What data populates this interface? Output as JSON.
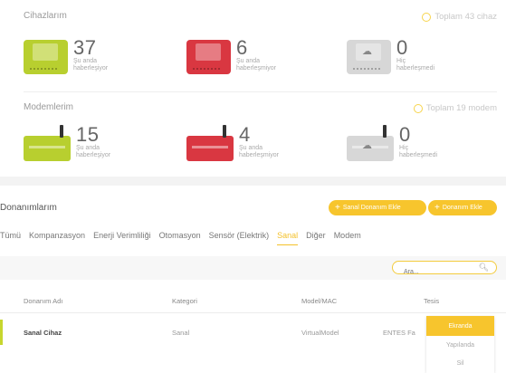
{
  "devices": {
    "title": "Cihazlarım",
    "total": "Toplam 43 cihaz",
    "stats": [
      {
        "count": "37",
        "line1": "Şu anda",
        "line2": "haberleşiyor",
        "color": "#b8cf2f"
      },
      {
        "count": "6",
        "line1": "Şu anda",
        "line2": "haberleşmiyor",
        "color": "#d93741"
      },
      {
        "count": "0",
        "line1": "Hiç",
        "line2": "haberleşmedi",
        "color": "#d7d7d7"
      }
    ]
  },
  "modems": {
    "title": "Modemlerim",
    "total": "Toplam 19 modem",
    "stats": [
      {
        "count": "15",
        "line1": "Şu anda",
        "line2": "haberleşiyor",
        "color": "#b8cf2f"
      },
      {
        "count": "4",
        "line1": "Şu anda",
        "line2": "haberleşmiyor",
        "color": "#d93741"
      },
      {
        "count": "0",
        "line1": "Hiç",
        "line2": "haberleşmedi",
        "color": "#d7d7d7"
      }
    ]
  },
  "hardware": {
    "title": "Donanımlarım",
    "add_virtual": "Sanal Donanım Ekle",
    "add_hardware": "Donanım Ekle",
    "tabs": [
      "Tümü",
      "Kompanzasyon",
      "Enerji Verimliliği",
      "Otomasyon",
      "Sensör (Elektrik)",
      "Sanal",
      "Diğer",
      "Modem"
    ],
    "active_tab": "Sanal",
    "search_placeholder": "Ara...",
    "columns": [
      "Donanım Adı",
      "Kategori",
      "Model/MAC",
      "Tesis"
    ],
    "rows": [
      {
        "name": "Sanal Cihaz",
        "category": "Sanal",
        "model": "VirtualModel",
        "facility": "ENTES Fa"
      }
    ],
    "dropdown": [
      "Ekranda",
      "Yapılanda",
      "Sil"
    ]
  },
  "colors": {
    "accent": "#f7c52d",
    "ok": "#b8cf2f",
    "error": "#d93741"
  }
}
